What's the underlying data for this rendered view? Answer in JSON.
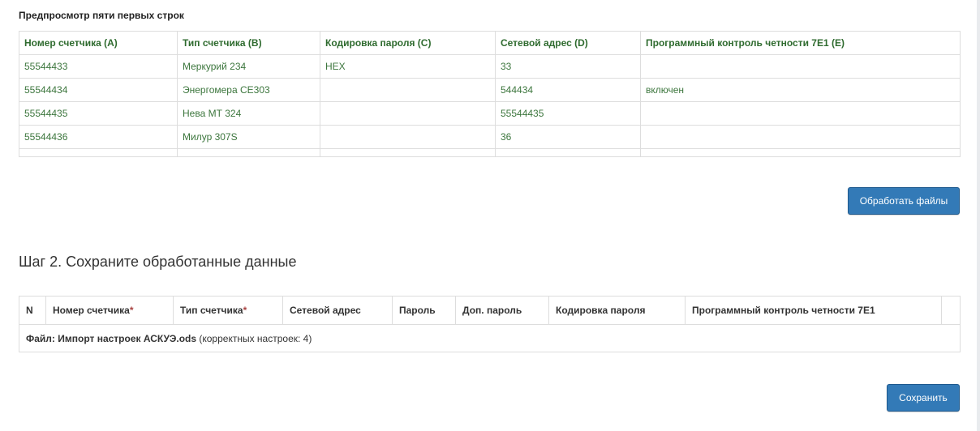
{
  "preview": {
    "title": "Предпросмотр пяти первых строк",
    "columns": [
      "Номер счетчика (A)",
      "Тип счетчика (B)",
      "Кодировка пароля (C)",
      "Сетевой адрес (D)",
      "Программный контроль четности 7E1 (E)"
    ],
    "rows": [
      [
        "55544433",
        "Меркурий 234",
        "HEX",
        "33",
        ""
      ],
      [
        "55544434",
        "Энергомера CE303",
        "",
        "544434",
        "включен"
      ],
      [
        "55544435",
        "Нева МТ 324",
        "",
        "55544435",
        ""
      ],
      [
        "55544436",
        "Милур 307S",
        "",
        "36",
        ""
      ],
      [
        "",
        "",
        "",
        "",
        ""
      ]
    ]
  },
  "buttons": {
    "process_label": "Обработать файлы",
    "save_label": "Сохранить"
  },
  "step2": {
    "title": "Шаг 2. Сохраните обработанные данные",
    "columns": [
      {
        "label": "N",
        "required": false
      },
      {
        "label": "Номер счетчика",
        "required": true
      },
      {
        "label": "Тип счетчика",
        "required": true
      },
      {
        "label": "Сетевой адрес",
        "required": false
      },
      {
        "label": "Пароль",
        "required": false
      },
      {
        "label": "Доп. пароль",
        "required": false
      },
      {
        "label": "Кодировка пароля",
        "required": false
      },
      {
        "label": "Программный контроль четности 7E1",
        "required": false
      },
      {
        "label": "",
        "required": false
      }
    ],
    "required_mark": "*",
    "file_label": "Файл: Импорт настроек АСКУЭ.ods",
    "file_count": "(корректных настроек: 4)"
  },
  "colors": {
    "preview_text": "#3c763d",
    "preview_header": "#2f6b2f",
    "button_primary": "#337ab7",
    "required_mark": "#a94442"
  }
}
